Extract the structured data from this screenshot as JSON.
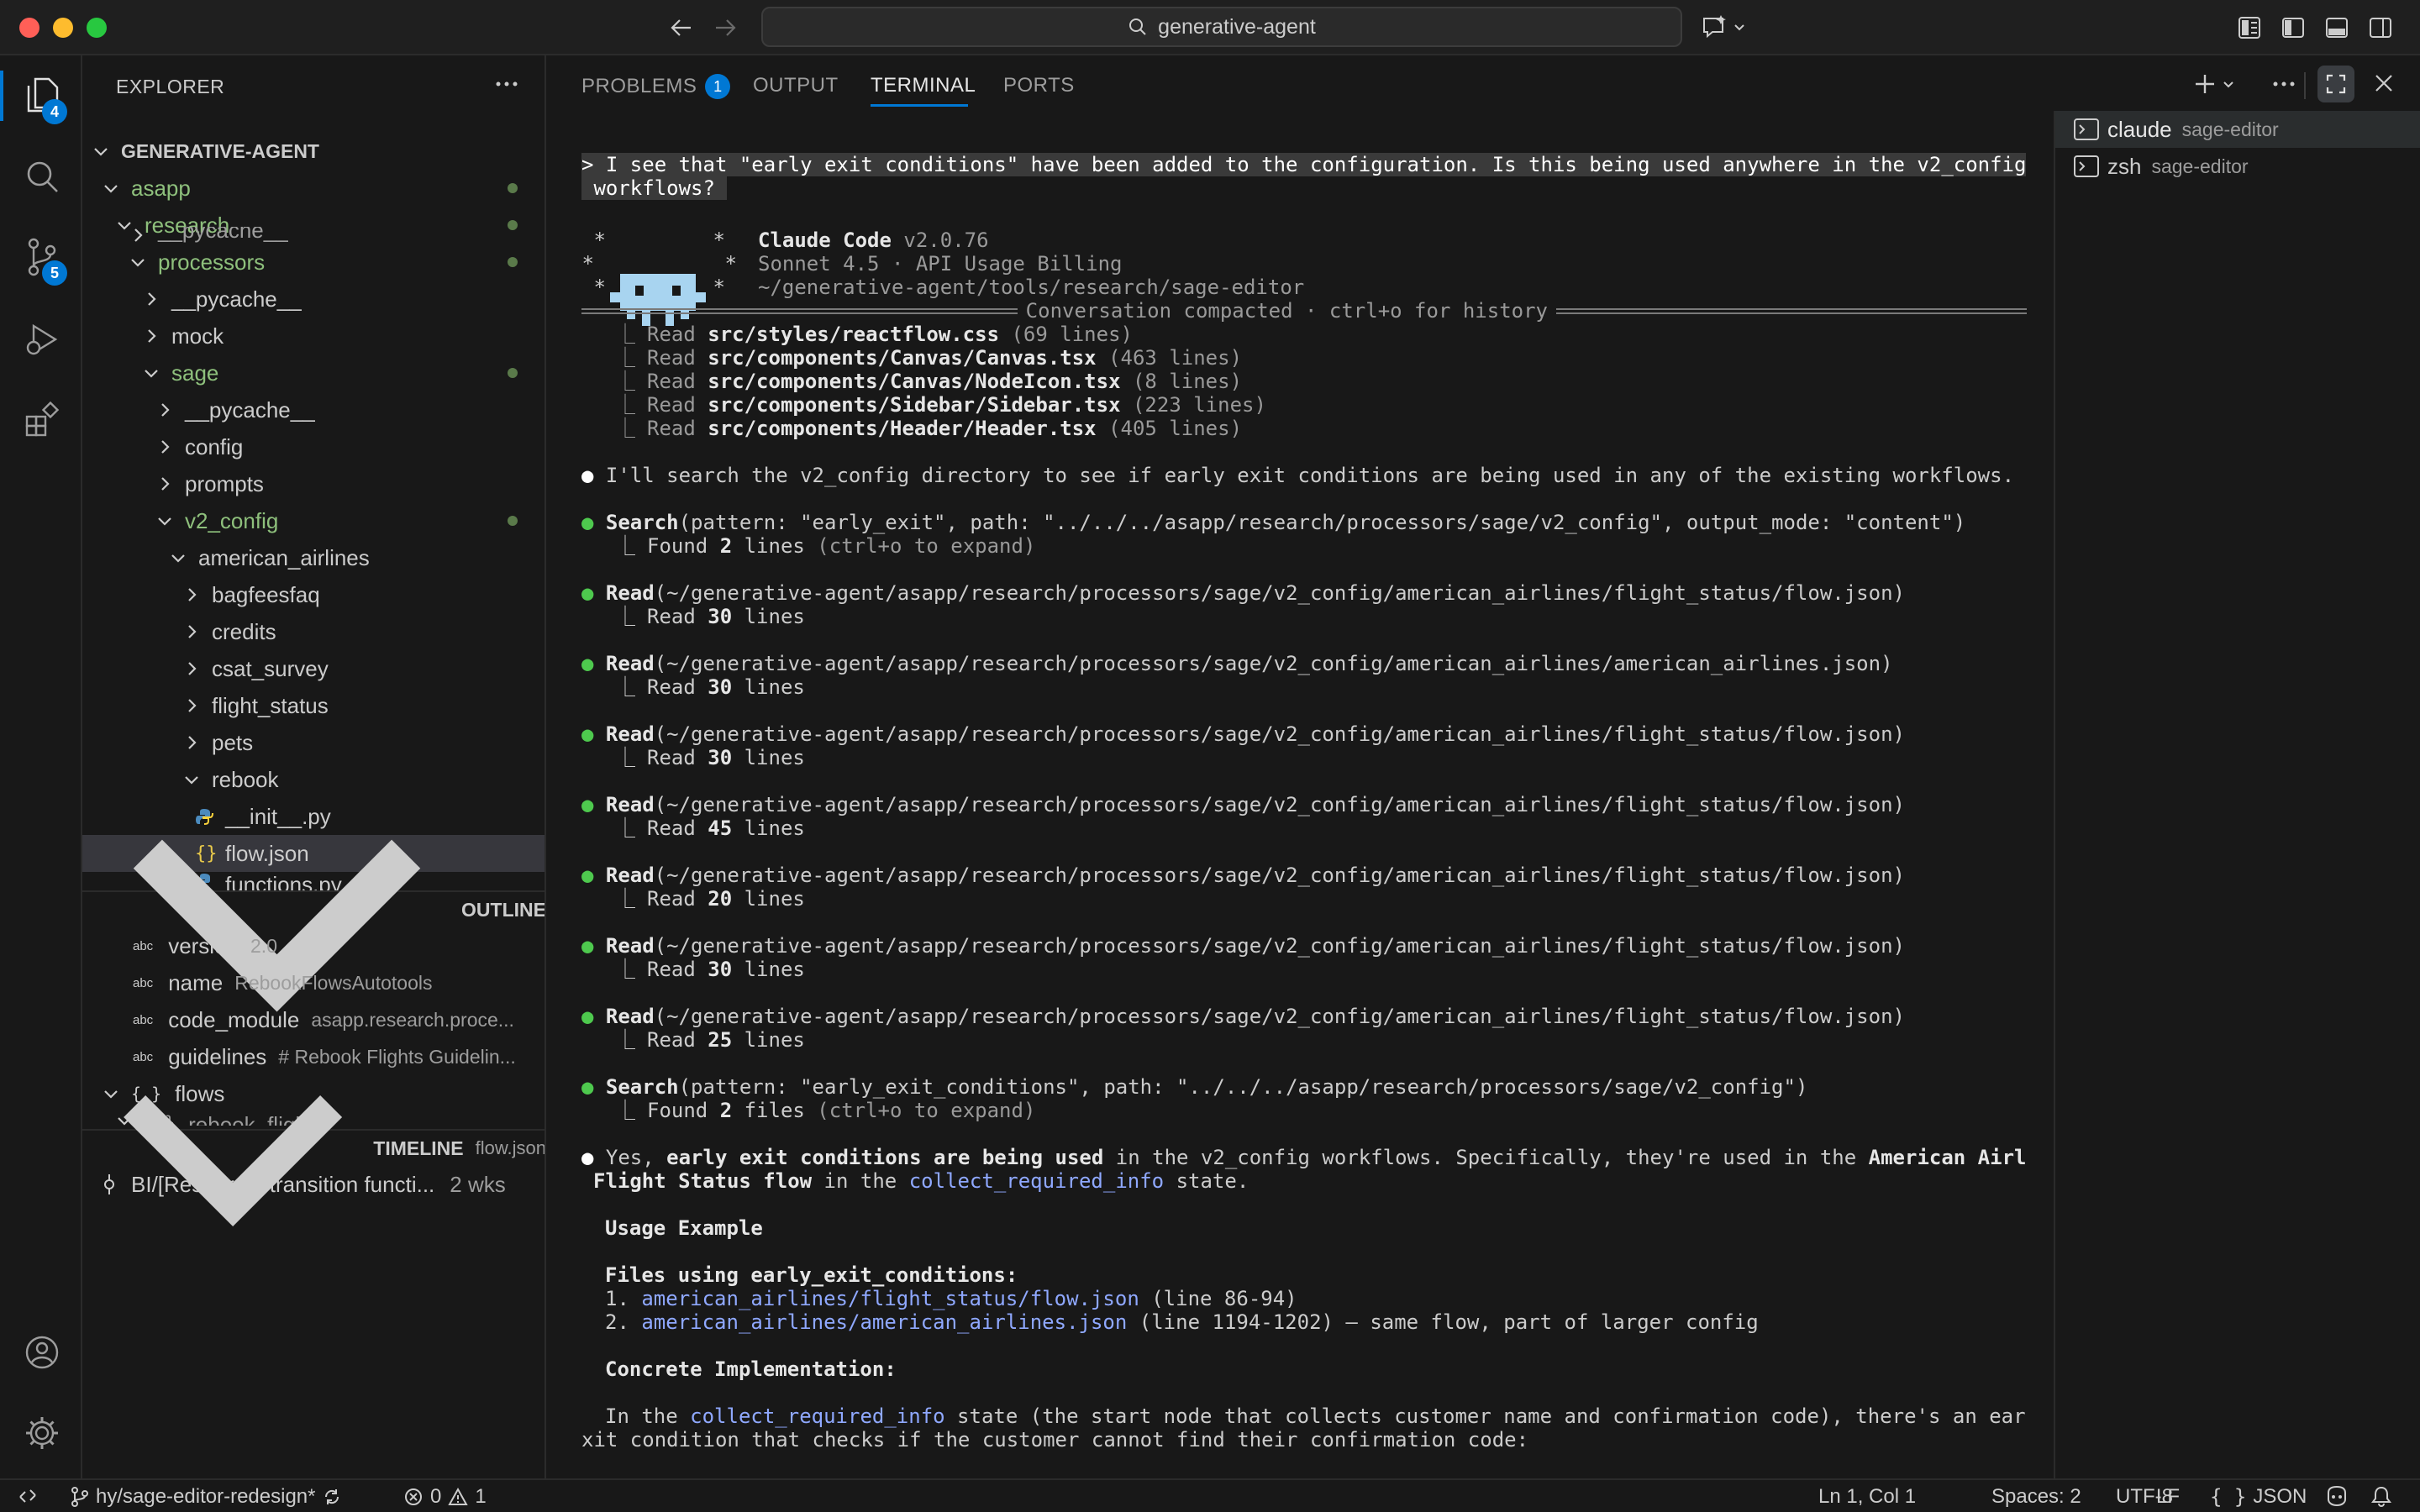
{
  "window": {
    "search_text": "generative-agent"
  },
  "activity": {
    "explorer_badge": "4",
    "scm_badge": "5"
  },
  "explorer": {
    "title": "EXPLORER",
    "root": "GENERATIVE-AGENT",
    "tree": [
      {
        "label": "asapp"
      },
      {
        "label": "research"
      },
      {
        "label": "__pycache__"
      },
      {
        "label": "processors"
      },
      {
        "label": "__pycache__"
      },
      {
        "label": "mock"
      },
      {
        "label": "sage"
      },
      {
        "label": "__pycache__"
      },
      {
        "label": "config"
      },
      {
        "label": "prompts"
      },
      {
        "label": "v2_config"
      },
      {
        "label": "american_airlines"
      },
      {
        "label": "bagfeesfaq"
      },
      {
        "label": "credits"
      },
      {
        "label": "csat_survey"
      },
      {
        "label": "flight_status"
      },
      {
        "label": "pets"
      },
      {
        "label": "rebook"
      },
      {
        "label": "__init__.py"
      },
      {
        "label": "flow.json"
      },
      {
        "label": "functions.py"
      }
    ]
  },
  "outline": {
    "title": "OUTLINE",
    "items": [
      {
        "key": "version",
        "value": "2.0"
      },
      {
        "key": "name",
        "value": "RebookFlowsAutotools"
      },
      {
        "key": "code_module",
        "value": "asapp.research.proce..."
      },
      {
        "key": "guidelines",
        "value": "# Rebook Flights Guidelin..."
      },
      {
        "key": "flows",
        "value": ""
      },
      {
        "key": "rebook_flights",
        "value": ""
      }
    ],
    "abc": "abc",
    "braces": "{ }"
  },
  "timeline": {
    "title": "TIMELINE",
    "file": "flow.json",
    "entry": "BI/[Research] transition functi...",
    "age": "2 wks"
  },
  "panel": {
    "tabs": [
      "PROBLEMS",
      "OUTPUT",
      "TERMINAL",
      "PORTS"
    ],
    "problems_count": "1"
  },
  "terminal": {
    "prompt_line1": "> I see that \"early exit conditions\" have been added to the configuration. Is this being used anywhere in the v2_config",
    "prompt_line2": " workflows? ",
    "logo1": " *",
    "logo2": " *",
    "logo3": " *",
    "logo4": " *",
    "logo5": " *",
    "logo6": " *",
    "app_name": "Claude Code",
    "app_version": " v2.0.76",
    "model": "Sonnet 4.5 · API Usage Billing",
    "cwd": "~/generative-agent/tools/research/sage-editor",
    "compacted": "Conversation compacted · ctrl+o for history",
    "reads": [
      {
        "path": "src/styles/reactflow.css",
        "count": " (69 lines)"
      },
      {
        "path": "src/components/Canvas/Canvas.tsx",
        "count": " (463 lines)"
      },
      {
        "path": "src/components/Canvas/NodeIcon.tsx",
        "count": " (8 lines)"
      },
      {
        "path": "src/components/Sidebar/Sidebar.tsx",
        "count": " (223 lines)"
      },
      {
        "path": "src/components/Header/Header.tsx",
        "count": " (405 lines)"
      }
    ],
    "read_word": "Read ",
    "intro": "I'll search the v2_config directory to see if early exit conditions are being used in any of the existing workflows.",
    "tool_calls": [
      {
        "tool": "Search",
        "args": "(pattern: \"early_exit\", path: \"../../../asapp/research/processors/sage/v2_config\", output_mode: \"content\")",
        "r1": "Found ",
        "r2": "2",
        "r3": " lines",
        "r4": " (ctrl+o to expand)"
      },
      {
        "tool": "Read",
        "args": "(~/generative-agent/asapp/research/processors/sage/v2_config/american_airlines/flight_status/flow.json)",
        "r1": "Read ",
        "r2": "30",
        "r3": " lines",
        "r4": ""
      },
      {
        "tool": "Read",
        "args": "(~/generative-agent/asapp/research/processors/sage/v2_config/american_airlines/american_airlines.json)",
        "r1": "Read ",
        "r2": "30",
        "r3": " lines",
        "r4": ""
      },
      {
        "tool": "Read",
        "args": "(~/generative-agent/asapp/research/processors/sage/v2_config/american_airlines/flight_status/flow.json)",
        "r1": "Read ",
        "r2": "30",
        "r3": " lines",
        "r4": ""
      },
      {
        "tool": "Read",
        "args": "(~/generative-agent/asapp/research/processors/sage/v2_config/american_airlines/flight_status/flow.json)",
        "r1": "Read ",
        "r2": "45",
        "r3": " lines",
        "r4": ""
      },
      {
        "tool": "Read",
        "args": "(~/generative-agent/asapp/research/processors/sage/v2_config/american_airlines/flight_status/flow.json)",
        "r1": "Read ",
        "r2": "20",
        "r3": " lines",
        "r4": ""
      },
      {
        "tool": "Read",
        "args": "(~/generative-agent/asapp/research/processors/sage/v2_config/american_airlines/flight_status/flow.json)",
        "r1": "Read ",
        "r2": "30",
        "r3": " lines",
        "r4": ""
      },
      {
        "tool": "Read",
        "args": "(~/generative-agent/asapp/research/processors/sage/v2_config/american_airlines/flight_status/flow.json)",
        "r1": "Read ",
        "r2": "25",
        "r3": " lines",
        "r4": ""
      },
      {
        "tool": "Search",
        "args": "(pattern: \"early_exit_conditions\", path: \"../../../asapp/research/processors/sage/v2_config\")",
        "r1": "Found ",
        "r2": "2",
        "r3": " files",
        "r4": " (ctrl+o to expand)"
      }
    ],
    "answer": {
      "a1": "Yes, ",
      "a2": "early exit conditions are being used",
      "a3": " in the v2_config workflows. Specifically, they're used in the ",
      "a4": "American Airlines",
      "a5": "Flight Status flow",
      "a6": " in the ",
      "a7": "collect_required_info",
      "a8": " state.",
      "usage": "Usage Example",
      "files_head": "Files using early_exit_conditions:",
      "f1_num": "1. ",
      "f1_link": "american_airlines/flight_status/flow.json",
      "f1_rest": " (line 86-94)",
      "f2_num": "2. ",
      "f2_link": "american_airlines/american_airlines.json",
      "f2_rest": " (line 1194-1202) — same flow, part of larger config",
      "impl": "Concrete Implementation:",
      "p1": "In the ",
      "p2": "collect_required_info",
      "p3": " state (the start node that collects customer name and confirmation code), there's an early e",
      "p4": "xit condition that checks if the customer cannot find their confirmation code:"
    }
  },
  "terminal_list": [
    {
      "name": "claude",
      "cwd": "sage-editor"
    },
    {
      "name": "zsh",
      "cwd": "sage-editor"
    }
  ],
  "statusbar": {
    "branch": "hy/sage-editor-redesign*",
    "errors": "0",
    "warnings": "1",
    "position": "Ln 1, Col 1",
    "spaces": "Spaces: 2",
    "encoding": "UTF-8",
    "eol": "LF",
    "language": "JSON",
    "braces": "{ }"
  },
  "colors": {
    "accent": "#0078d4",
    "green": "#4ec94e",
    "link": "#8fa8ff",
    "mascot": "#a8d4f0"
  }
}
